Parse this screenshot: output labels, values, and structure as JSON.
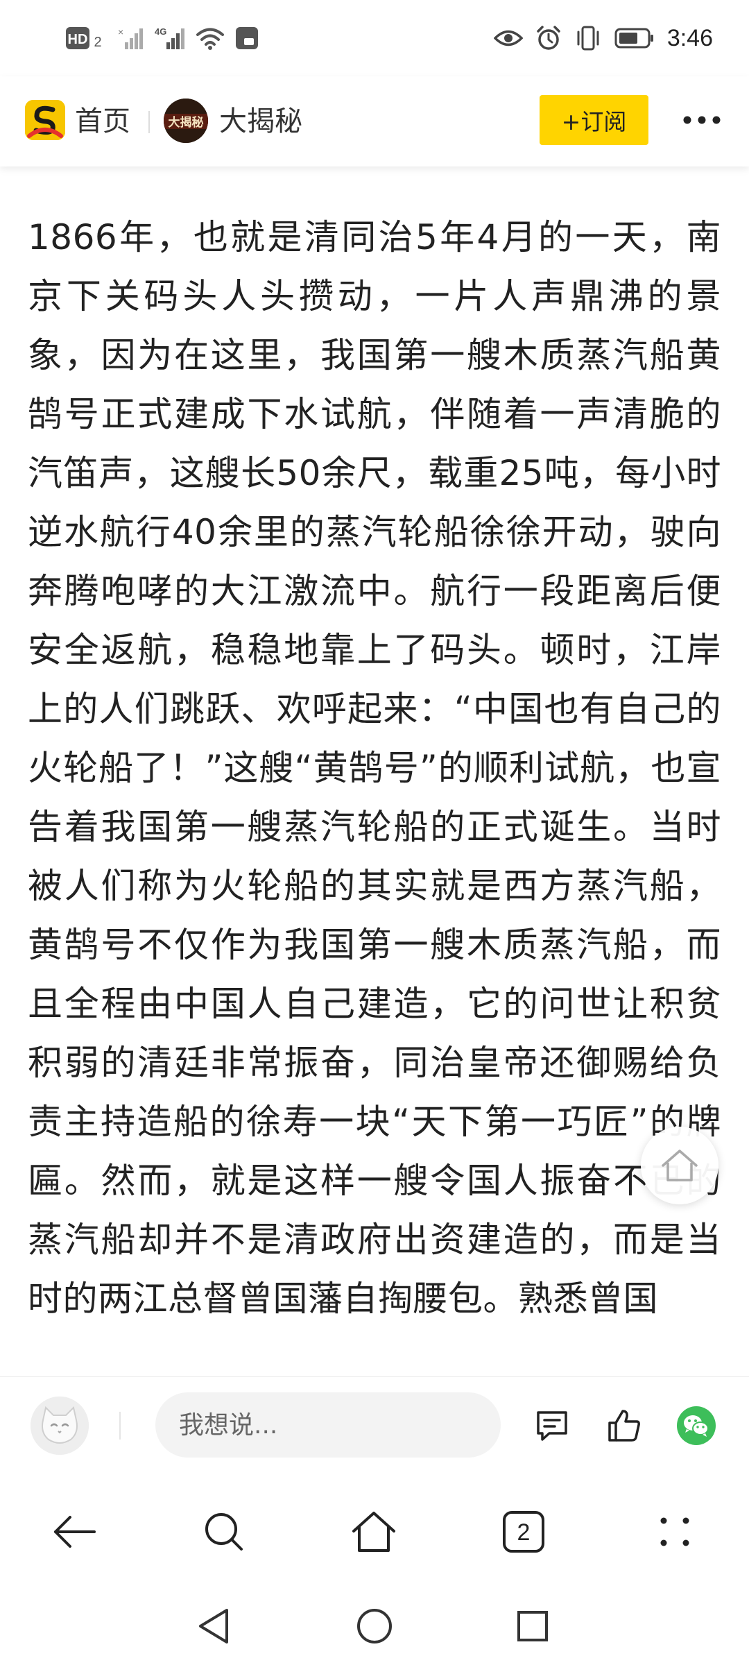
{
  "status_bar": {
    "network_badge": "HD",
    "network_badge_sub": "2",
    "signal_label": "4G",
    "time": "3:46"
  },
  "header": {
    "home_label": "首页",
    "channel_name": "大揭秘",
    "channel_avatar_text": "大揭秘",
    "subscribe_label": "+订阅",
    "accent_color": "#FFD400"
  },
  "article": {
    "body": "1866年，也就是清同治5年4月的一天，南京下关码头人头攒动，一片人声鼎沸的景象，因为在这里，我国第一艘木质蒸汽船黄鹄号正式建成下水试航，伴随着一声清脆的汽笛声，这艘长50余尺，载重25吨，每小时逆水航行40余里的蒸汽轮船徐徐开动，驶向奔腾咆哮的大江激流中。航行一段距离后便安全返航，稳稳地靠上了码头。顿时，江岸上的人们跳跃、欢呼起来：“中国也有自己的火轮船了！”这艘“黄鹄号”的顺利试航，也宣告着我国第一艘蒸汽轮船的正式诞生。当时被人们称为火轮船的其实就是西方蒸汽船，黄鹄号不仅作为我国第一艘木质蒸汽船，而且全程由中国人自己建造，它的问世让积贫积弱的清廷非常振奋，同治皇帝还御赐给负责主持造船的徐寿一块“天下第一巧匠”的牌匾。然而，就是这样一艘令国人振奋不已的蒸汽船却并不是清政府出资建造的，而是当时的两江总督曾国藩自掏腰包。熟悉曾国"
  },
  "comment_bar": {
    "input_placeholder": "我想说..."
  },
  "browser_toolbar": {
    "tab_count": "2"
  },
  "icons": {
    "eye": "eye-icon",
    "alarm": "alarm-icon",
    "vibrate": "vibrate-icon",
    "battery": "battery-icon",
    "wifi": "wifi-icon",
    "comment": "comment-icon",
    "like": "thumbs-up-icon",
    "wechat": "wechat-icon",
    "back": "back-arrow-icon",
    "search": "search-icon",
    "home": "home-icon",
    "menu": "dots-menu-icon"
  },
  "colors": {
    "wechat_green": "#3DBE5A",
    "text": "#222222"
  }
}
